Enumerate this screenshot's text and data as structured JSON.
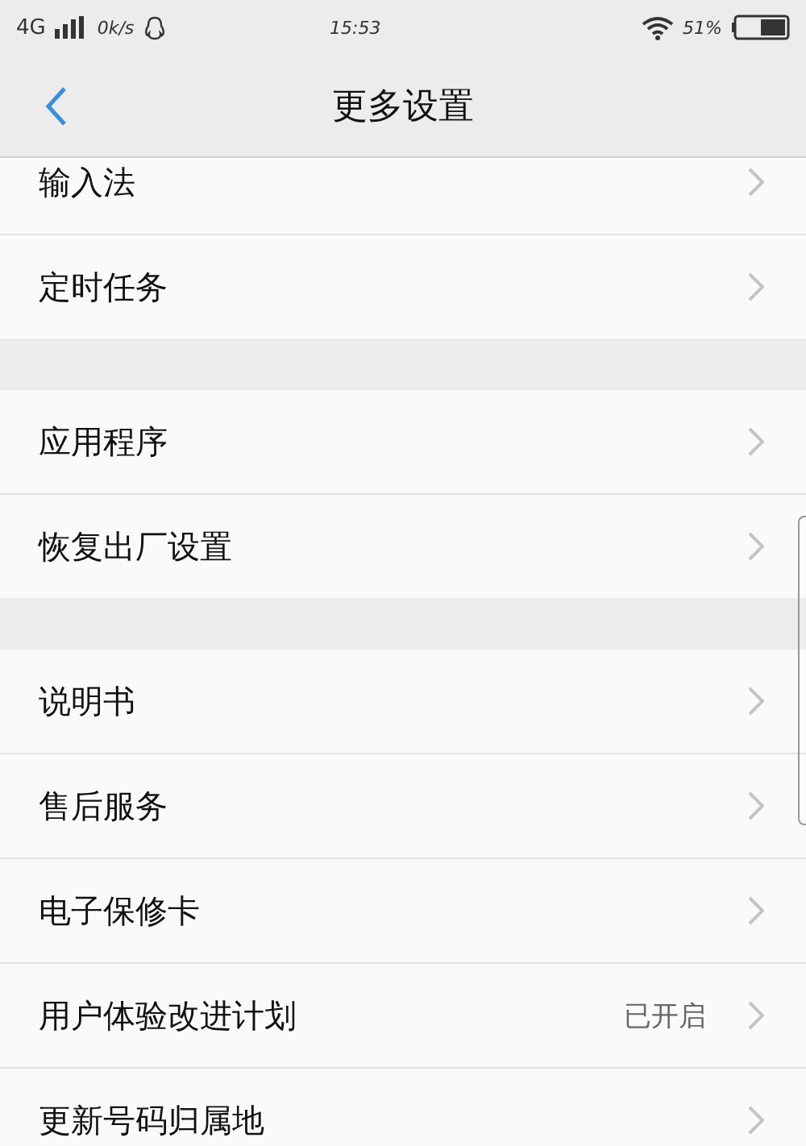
{
  "status_bar": {
    "network": "4G",
    "speed": "0k/s",
    "time": "15:53",
    "battery": "51%"
  },
  "header": {
    "title": "更多设置"
  },
  "groups": [
    {
      "items": [
        {
          "label": "输入法"
        },
        {
          "label": "定时任务"
        }
      ]
    },
    {
      "items": [
        {
          "label": "应用程序"
        },
        {
          "label": "恢复出厂设置"
        }
      ]
    },
    {
      "items": [
        {
          "label": "说明书"
        },
        {
          "label": "售后服务"
        },
        {
          "label": "电子保修卡"
        },
        {
          "label": "用户体验改进计划",
          "value": "已开启"
        },
        {
          "label": "更新号码归属地"
        }
      ]
    }
  ]
}
